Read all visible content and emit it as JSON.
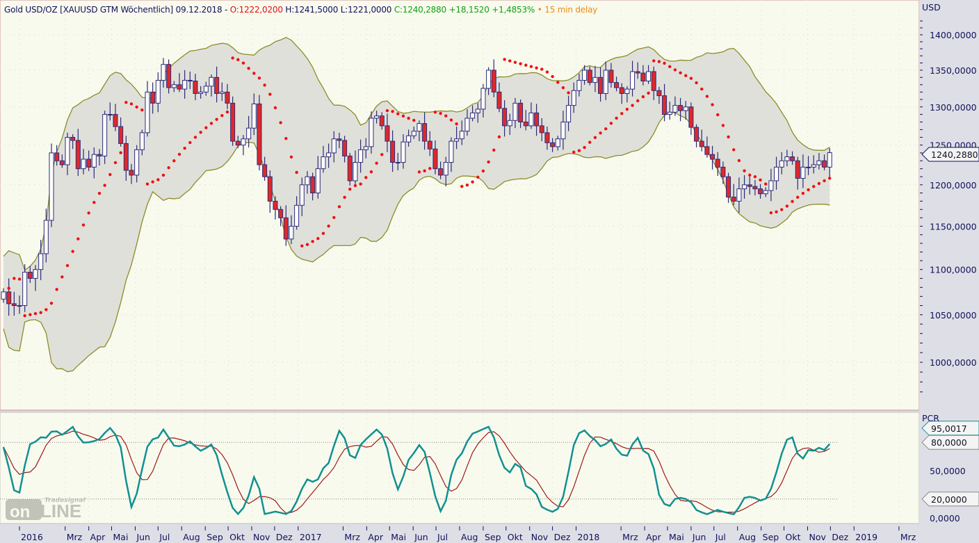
{
  "header": {
    "instrument": "Gold USD/OZ [XAUUSD GTM Wöchentlich]",
    "date": "09.12.2018",
    "separator": "-",
    "open": "O:1222,0200",
    "high": "H:1241,5000",
    "low": "L:1221,0000",
    "close": "C:1240,2880",
    "change": "+18,1520",
    "change_pct": "+1,4853%",
    "delay": "• 15 min delay"
  },
  "colors": {
    "up_body": "#ffffff",
    "down_body": "#e02828",
    "candle_outline": "#2a2a7a",
    "band_fill": "#e0e0da",
    "band_line": "#8c8c28",
    "sar": "#ee1111",
    "stoch_k": "#119090",
    "stoch_d": "#a01818",
    "bg": "#f8faee",
    "axis_bg": "#dedee6"
  },
  "logo": "Tradesignal online",
  "chart_data": [
    {
      "type": "candlestick",
      "title": "Gold USD/OZ weekly",
      "ylabel": "USD",
      "yscale": "log",
      "ylim": [
        960,
        1420
      ],
      "yticks": [
        "1000,0000",
        "1050,0000",
        "1100,0000",
        "1150,0000",
        "1200,0000",
        "1250,0000",
        "1300,0000",
        "1350,0000",
        "1400,0000"
      ],
      "ytick_values": [
        1000,
        1050,
        1100,
        1150,
        1200,
        1250,
        1300,
        1350,
        1400
      ],
      "last_price_tag": "1240,2880",
      "last_price": 1240.288,
      "start_date": "2015-12-11",
      "interval_days": 7,
      "closes": [
        1075,
        1062,
        1060,
        1060,
        1097,
        1090,
        1100,
        1118,
        1157,
        1240,
        1230,
        1225,
        1260,
        1256,
        1220,
        1232,
        1222,
        1238,
        1236,
        1290,
        1290,
        1274,
        1252,
        1218,
        1212,
        1244,
        1266,
        1320,
        1305,
        1336,
        1358,
        1326,
        1330,
        1324,
        1336,
        1335,
        1318,
        1320,
        1328,
        1340,
        1318,
        1320,
        1305,
        1255,
        1250,
        1258,
        1272,
        1304,
        1225,
        1210,
        1180,
        1170,
        1160,
        1135,
        1150,
        1175,
        1200,
        1210,
        1190,
        1220,
        1235,
        1240,
        1258,
        1256,
        1236,
        1205,
        1228,
        1244,
        1248,
        1285,
        1288,
        1275,
        1255,
        1228,
        1228,
        1254,
        1262,
        1268,
        1278,
        1255,
        1245,
        1220,
        1212,
        1228,
        1255,
        1258,
        1268,
        1285,
        1292,
        1297,
        1325,
        1350,
        1320,
        1298,
        1275,
        1282,
        1305,
        1280,
        1275,
        1292,
        1275,
        1266,
        1253,
        1248,
        1258,
        1280,
        1302,
        1322,
        1336,
        1350,
        1333,
        1340,
        1318,
        1350,
        1333,
        1326,
        1318,
        1324,
        1348,
        1346,
        1335,
        1348,
        1322,
        1315,
        1290,
        1293,
        1302,
        1295,
        1300,
        1273,
        1255,
        1248,
        1238,
        1232,
        1222,
        1210,
        1185,
        1180,
        1195,
        1200,
        1198,
        1195,
        1189,
        1193,
        1205,
        1222,
        1230,
        1235,
        1230,
        1208,
        1222,
        1222,
        1225,
        1230,
        1222,
        1240.288
      ],
      "overlays": [
        "Bollinger Bands (20,2)",
        "Parabolic SAR"
      ]
    },
    {
      "type": "line",
      "ylabel": "PCR",
      "ylim": [
        -5,
        100
      ],
      "yticks": [
        "0,0000",
        "50,0000"
      ],
      "ytick_values": [
        0,
        50
      ],
      "levels": [
        {
          "value": 80,
          "label": "80,0000"
        },
        {
          "value": 20,
          "label": "20,0000"
        }
      ],
      "last_value_tag": "95,0017",
      "series": [
        {
          "name": "%K"
        },
        {
          "name": "%D"
        }
      ]
    }
  ],
  "time_axis": [
    {
      "label": "2016",
      "date": [
        2016,
        1
      ]
    },
    {
      "label": "Mrz",
      "date": [
        2016,
        3
      ]
    },
    {
      "label": "Apr",
      "date": [
        2016,
        4
      ]
    },
    {
      "label": "Mai",
      "date": [
        2016,
        5
      ]
    },
    {
      "label": "Jun",
      "date": [
        2016,
        6
      ]
    },
    {
      "label": "Jul",
      "date": [
        2016,
        7
      ]
    },
    {
      "label": "Aug",
      "date": [
        2016,
        8
      ]
    },
    {
      "label": "Sep",
      "date": [
        2016,
        9
      ]
    },
    {
      "label": "Okt",
      "date": [
        2016,
        10
      ]
    },
    {
      "label": "Nov",
      "date": [
        2016,
        11
      ]
    },
    {
      "label": "Dez",
      "date": [
        2016,
        12
      ]
    },
    {
      "label": "2017",
      "date": [
        2017,
        1
      ]
    },
    {
      "label": "Mrz",
      "date": [
        2017,
        3
      ]
    },
    {
      "label": "Apr",
      "date": [
        2017,
        4
      ]
    },
    {
      "label": "Mai",
      "date": [
        2017,
        5
      ]
    },
    {
      "label": "Jun",
      "date": [
        2017,
        6
      ]
    },
    {
      "label": "Jul",
      "date": [
        2017,
        7
      ]
    },
    {
      "label": "Aug",
      "date": [
        2017,
        8
      ]
    },
    {
      "label": "Sep",
      "date": [
        2017,
        9
      ]
    },
    {
      "label": "Okt",
      "date": [
        2017,
        10
      ]
    },
    {
      "label": "Nov",
      "date": [
        2017,
        11
      ]
    },
    {
      "label": "Dez",
      "date": [
        2017,
        12
      ]
    },
    {
      "label": "2018",
      "date": [
        2018,
        1
      ]
    },
    {
      "label": "Mrz",
      "date": [
        2018,
        3
      ]
    },
    {
      "label": "Apr",
      "date": [
        2018,
        4
      ]
    },
    {
      "label": "Mai",
      "date": [
        2018,
        5
      ]
    },
    {
      "label": "Jun",
      "date": [
        2018,
        6
      ]
    },
    {
      "label": "Jul",
      "date": [
        2018,
        7
      ]
    },
    {
      "label": "Aug",
      "date": [
        2018,
        8
      ]
    },
    {
      "label": "Sep",
      "date": [
        2018,
        9
      ]
    },
    {
      "label": "Okt",
      "date": [
        2018,
        10
      ]
    },
    {
      "label": "Nov",
      "date": [
        2018,
        11
      ]
    },
    {
      "label": "Dez",
      "date": [
        2018,
        12
      ]
    },
    {
      "label": "2019",
      "date": [
        2019,
        1
      ]
    },
    {
      "label": "Mrz",
      "date": [
        2019,
        3
      ]
    }
  ]
}
